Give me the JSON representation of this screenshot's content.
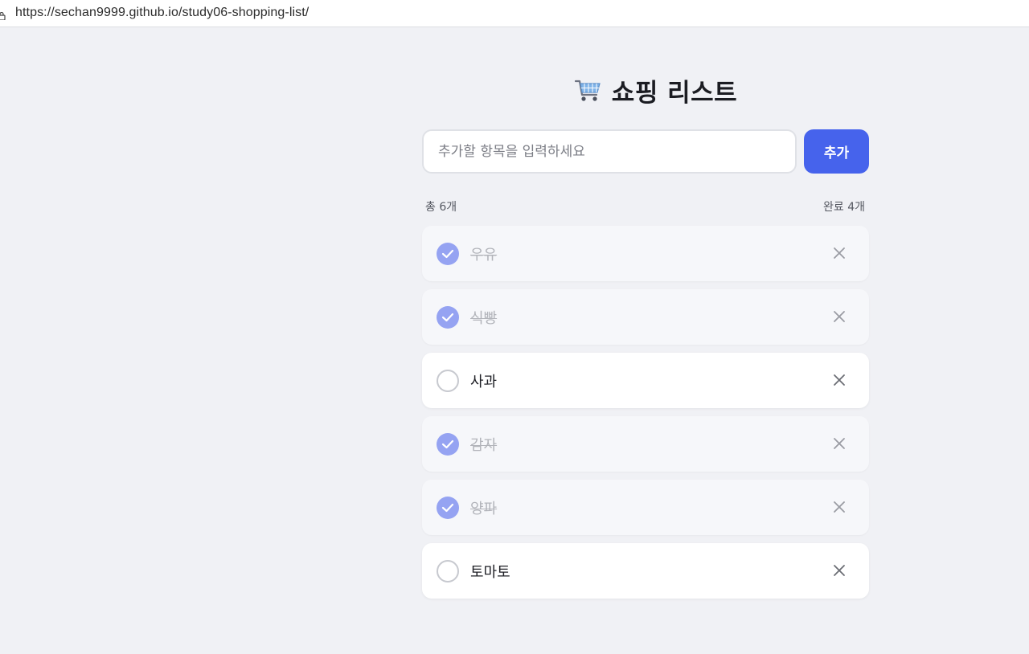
{
  "browser": {
    "url": "https://sechan9999.github.io/study06-shopping-list/"
  },
  "app": {
    "title": "쇼핑 리스트",
    "title_icon": "shopping-cart-icon",
    "input": {
      "placeholder": "추가할 항목을 입력하세요",
      "value": ""
    },
    "add_label": "추가",
    "stats": {
      "total": "총 6개",
      "done": "완료 4개"
    },
    "items": [
      {
        "label": "우유",
        "done": true
      },
      {
        "label": "식빵",
        "done": true
      },
      {
        "label": "사과",
        "done": false
      },
      {
        "label": "감자",
        "done": true
      },
      {
        "label": "양파",
        "done": true
      },
      {
        "label": "토마토",
        "done": false
      }
    ]
  },
  "colors": {
    "accent": "#4663ec",
    "checked": "#95a3f2",
    "background": "#f0f1f5"
  }
}
